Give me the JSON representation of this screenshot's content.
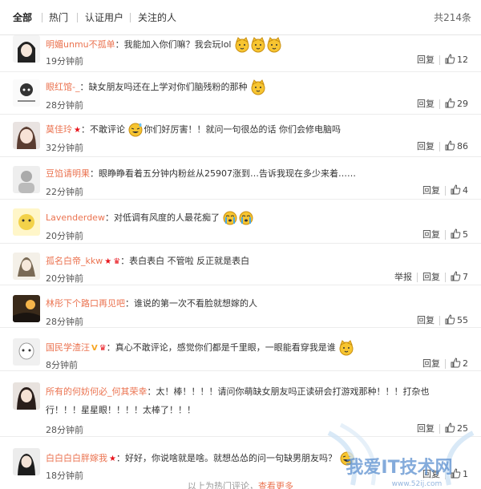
{
  "tabs": [
    {
      "label": "全部"
    },
    {
      "label": "热门"
    },
    {
      "label": "认证用户"
    },
    {
      "label": "关注的人"
    }
  ],
  "total": "共214条",
  "labels": {
    "reply": "回复",
    "report": "举报"
  },
  "comments": [
    {
      "user": "明媚unmu不孤单",
      "text": "：我能加入你们嘛？我会玩lol",
      "time": "19分钟前",
      "likes": "12"
    },
    {
      "user": "眼红馆-_",
      "text": "：缺女朋友吗还在上学对你们脑残粉的那种",
      "time": "28分钟前",
      "likes": "29"
    },
    {
      "user": "莫佳玲",
      "text": "：不敢评论",
      "text_b": "你们好厉害！！就问一句很怂的话 你们会修电脑吗",
      "time": "32分钟前",
      "likes": "86"
    },
    {
      "user": "豆馅请明果",
      "text": "：眼睁睁看着五分钟内粉丝从25907涨到…告诉我现在多少来着……",
      "time": "22分钟前",
      "likes": "4"
    },
    {
      "user": "Lavenderdew",
      "text": "：对低调有风度的人最花痴了",
      "time": "20分钟前",
      "likes": "5"
    },
    {
      "user": "孤名白帝_kkw",
      "text": "：表白表白 不管啦 反正就是表白",
      "time": "20分钟前",
      "likes": "7"
    },
    {
      "user": "林彤下个路口再见吧",
      "text": "：谁说的第一次不看脸就想嫁的人",
      "time": "28分钟前",
      "likes": "55"
    },
    {
      "user": "国民学渣汪",
      "text": "：真心不敢评论，感觉你们都是千里眼，一眼能看穿我是谁",
      "time": "8分钟前",
      "likes": "2"
    },
    {
      "user": "所有的何妨何必_何其荣幸",
      "text": "：太！棒！！！！请问你萌缺女朋友吗正读研会打游戏那种！！！打杂也",
      "text2": "行！！！星星眼！！！！太棒了！！！",
      "time": "28分钟前",
      "likes": "25"
    },
    {
      "user": "白白白白胖嫁我",
      "text": "：好好，你说啥就是啥。就想怂怂的问一句缺男朋友吗？",
      "time": "18分钟前",
      "likes": "1"
    }
  ],
  "more": {
    "text": "以上为热门评论，",
    "link": "查看更多"
  },
  "watermark": {
    "title": "我爱IT技术网",
    "url": "www.52ij.com"
  },
  "colors": {
    "username": "#eb7350",
    "accent_red": "#e8141c",
    "emoji_yellow": "#f7c531"
  }
}
